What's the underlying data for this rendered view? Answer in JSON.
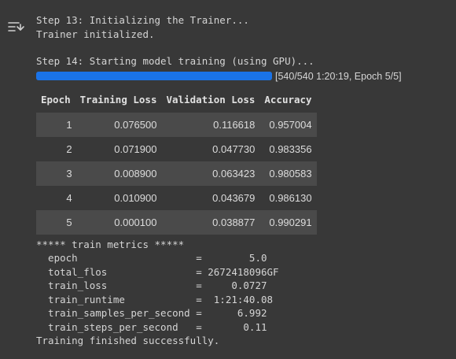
{
  "log_lines": {
    "step13": "Step 13: Initializing the Trainer...",
    "trainer_init": "Trainer initialized.",
    "step14": "Step 14: Starting model training (using GPU)..."
  },
  "progress": {
    "fraction": 1.0,
    "text": "[540/540 1:20:19, Epoch 5/5]"
  },
  "table": {
    "headers": [
      "Epoch",
      "Training Loss",
      "Validation Loss",
      "Accuracy"
    ],
    "rows": [
      [
        "1",
        "0.076500",
        "0.116618",
        "0.957004"
      ],
      [
        "2",
        "0.071900",
        "0.047730",
        "0.983356"
      ],
      [
        "3",
        "0.008900",
        "0.063423",
        "0.980583"
      ],
      [
        "4",
        "0.010900",
        "0.043679",
        "0.986130"
      ],
      [
        "5",
        "0.000100",
        "0.038877",
        "0.990291"
      ]
    ]
  },
  "metrics": {
    "header": "***** train metrics *****",
    "lines": [
      "  epoch                    =        5.0",
      "  total_flos               = 2672418096GF",
      "  train_loss               =     0.0727",
      "  train_runtime            =  1:21:40.08",
      "  train_samples_per_second =      6.992",
      "  train_steps_per_second   =       0.11"
    ]
  },
  "footer": "Training finished successfully.",
  "icons": {
    "output_toggle": "output-actions-icon"
  },
  "colors": {
    "background": "#383838",
    "progress": "#1a73e8",
    "row_stripe": "#4a4a4a"
  }
}
